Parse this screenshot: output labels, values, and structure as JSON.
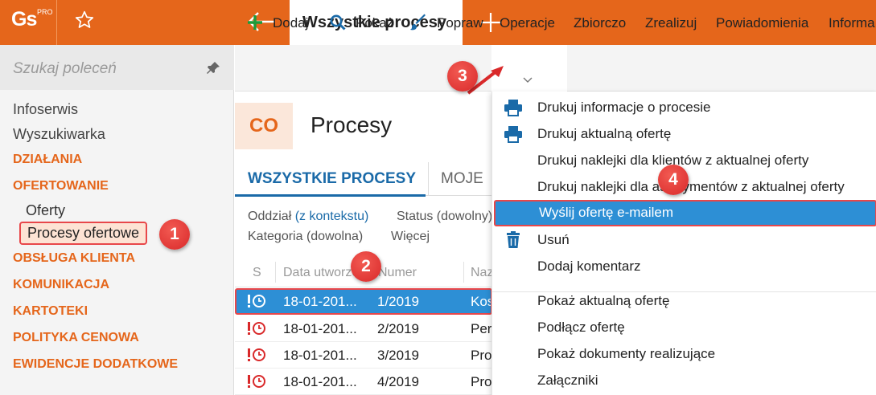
{
  "app": {
    "logo_text": "Gs",
    "logo_suffix": "PRO",
    "active_tab": "Wszystkie procesy"
  },
  "sidebar": {
    "search_placeholder": "Szukaj poleceń",
    "items": [
      {
        "label": "Infoserwis",
        "kind": "item"
      },
      {
        "label": "Wyszukiwarka",
        "kind": "item"
      },
      {
        "label": "DZIAŁANIA",
        "kind": "section"
      },
      {
        "label": "OFERTOWANIE",
        "kind": "section"
      },
      {
        "label": "Oferty",
        "kind": "sub"
      },
      {
        "label": "Procesy ofertowe",
        "kind": "sub-selected"
      },
      {
        "label": "OBSŁUGA KLIENTA",
        "kind": "section"
      },
      {
        "label": "KOMUNIKACJA",
        "kind": "section"
      },
      {
        "label": "KARTOTEKI",
        "kind": "section"
      },
      {
        "label": "POLITYKA CENOWA",
        "kind": "section"
      },
      {
        "label": "EWIDENCJE DODATKOWE",
        "kind": "section"
      }
    ]
  },
  "toolbar": {
    "add": "Dodaj",
    "show": "Pokaż",
    "edit": "Popraw",
    "operations": "Operacje",
    "summary": "Zbiorczo",
    "realize": "Zrealizuj",
    "notifications": "Powiadomienia",
    "info": "Informa"
  },
  "page": {
    "badge": "CO",
    "title": "Procesy"
  },
  "tabs": {
    "all": "WSZYSTKIE PROCESY",
    "mine": "MOJE"
  },
  "filters": {
    "branch_label": "Oddział",
    "branch_value": "(z kontekstu)",
    "status_label": "Status (dowolny)",
    "category_label": "Kategoria (dowolna)",
    "more_label": "Więcej"
  },
  "grid": {
    "headers": {
      "s": "S",
      "date": "Data utworzenia",
      "number": "Numer",
      "name": "Nazwa"
    },
    "rows": [
      {
        "date": "18-01-201...",
        "number": "1/2019",
        "name": "Kos"
      },
      {
        "date": "18-01-201...",
        "number": "2/2019",
        "name": "Per"
      },
      {
        "date": "18-01-201...",
        "number": "3/2019",
        "name": "Pro"
      },
      {
        "date": "18-01-201...",
        "number": "4/2019",
        "name": "Pro"
      }
    ]
  },
  "menu": {
    "items": [
      "Drukuj informacje o procesie",
      "Drukuj aktualną ofertę",
      "Drukuj naklejki dla klientów z aktualnej oferty",
      "Drukuj naklejki dla asortymentów z aktualnej oferty",
      "Wyślij ofertę e-mailem",
      "Usuń",
      "Dodaj komentarz",
      "Pokaż aktualną ofertę",
      "Podłącz ofertę",
      "Pokaż dokumenty realizujące",
      "Załączniki"
    ]
  },
  "callouts": [
    "1",
    "2",
    "3",
    "4"
  ],
  "colors": {
    "accent": "#e5661b",
    "selection": "#2d8fd5",
    "callout": "#e8474a",
    "link": "#1a6aa8"
  }
}
